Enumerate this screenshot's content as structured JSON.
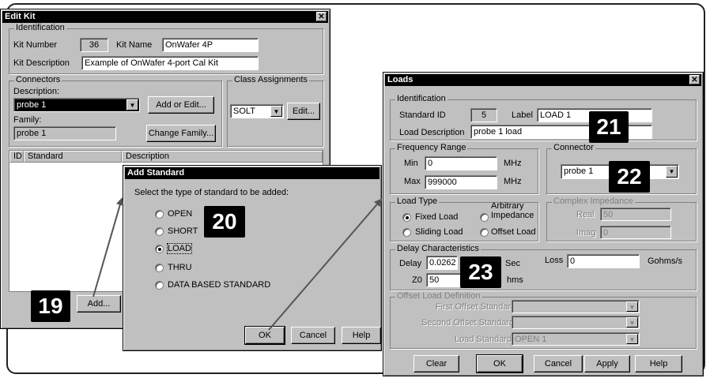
{
  "edit_kit": {
    "title": "Edit Kit",
    "identification_label": "Identification",
    "kit_number_label": "Kit Number",
    "kit_number_value": "36",
    "kit_name_label": "Kit Name",
    "kit_name_value": "OnWafer 4P",
    "kit_description_label": "Kit Description",
    "kit_description_value": "Example of OnWafer 4-port Cal Kit",
    "connectors_label": "Connectors",
    "description_label": "Description:",
    "connector_value": "probe 1",
    "add_or_edit_label": "Add or Edit...",
    "family_label": "Family:",
    "family_value": "probe 1",
    "change_family_label": "Change Family...",
    "class_assignments_label": "Class Assignments",
    "class_value": "SOLT",
    "edit_label": "Edit...",
    "columns": [
      "ID",
      "Standard",
      "Description"
    ],
    "add_button_label": "Add..."
  },
  "add_standard": {
    "title": "Add Standard",
    "prompt": "Select the type of standard to be added:",
    "options": [
      "OPEN",
      "SHORT",
      "LOAD",
      "THRU",
      "DATA BASED STANDARD"
    ],
    "selected": "LOAD",
    "ok_label": "OK",
    "cancel_label": "Cancel",
    "help_label": "Help"
  },
  "loads": {
    "title": "Loads",
    "identification_label": "Identification",
    "standard_id_label": "Standard ID",
    "standard_id_value": "5",
    "label_label": "Label",
    "label_value": "LOAD 1",
    "load_description_label": "Load Description",
    "load_description_value": "probe 1  load",
    "frequency_range_label": "Frequency Range",
    "min_label": "Min",
    "min_value": "0",
    "max_label": "Max",
    "max_value": "999000",
    "mhz_label": "MHz",
    "connector_label": "Connector",
    "connector_value": "probe 1",
    "load_type_label": "Load Type",
    "fixed_load_label": "Fixed Load",
    "arbitrary_label": "Arbitrary",
    "impedance_label": "Impedance",
    "sliding_load_label": "Sliding Load",
    "offset_load_label": "Offset Load",
    "complex_impedance_label": "Complex Impedance",
    "real_label": "Real",
    "real_value": "50",
    "imag_label": "Imag",
    "imag_value": "0",
    "delay_characteristics_label": "Delay Characteristics",
    "delay_label": "Delay",
    "delay_value": "0.0262",
    "sec_label": "Sec",
    "loss_label": "Loss",
    "loss_value": "0",
    "loss_unit_label": "Gohms/s",
    "z0_label": "Z0",
    "z0_value": "50",
    "ohms_label": "hms",
    "offset_load_definition_label": "Offset Load Definition",
    "first_offset_label": "First Offset Standard",
    "second_offset_label": "Second Offset Standard",
    "load_standard_label": "Load Standard",
    "load_standard_value": "OPEN 1",
    "clear_label": "Clear",
    "ok_label": "OK",
    "cancel_label": "Cancel",
    "apply_label": "Apply",
    "help_label": "Help"
  },
  "callouts": {
    "c19": "19",
    "c20": "20",
    "c21": "21",
    "c22": "22",
    "c23": "23"
  }
}
